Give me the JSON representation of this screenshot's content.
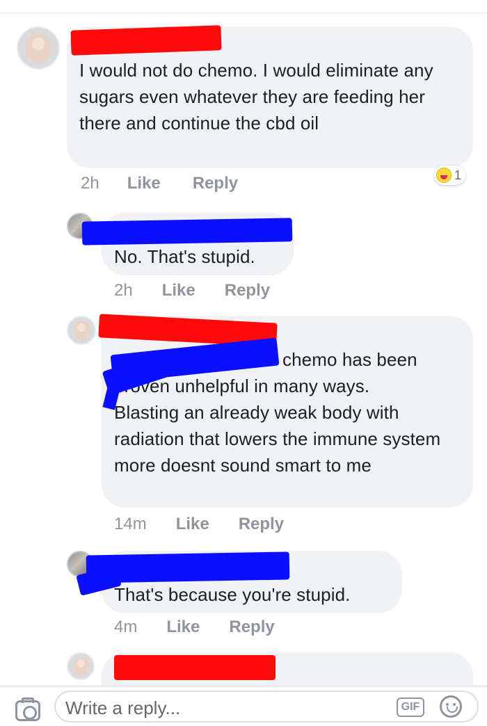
{
  "comments": [
    {
      "text": "I would not do chemo. I would eliminate any sugars even whatever they are feeding her there and continue the cbd oil",
      "time": "2h",
      "like": "Like",
      "reply": "Reply",
      "reaction": {
        "icon": "laugh-emoji-icon",
        "count": "1"
      }
    },
    {
      "text": "No. That's stupid.",
      "time": "2h",
      "like": "Like",
      "reply": "Reply"
    },
    {
      "text_visible_fragment_1": "chemo has been",
      "text_visible_fragment_2": "proven unhelpful in many ways.",
      "text_rest": "Blasting an already weak body with radiation that lowers the immune system more doesnt sound smart to me",
      "time": "14m",
      "like": "Like",
      "reply": "Reply"
    },
    {
      "text": "That's because you're stupid.",
      "time": "4m",
      "like": "Like",
      "reply": "Reply"
    }
  ],
  "composer": {
    "placeholder": "Write a reply...",
    "gif_label": "GIF",
    "camera_icon": "camera-icon",
    "emoji_icon": "smiley-icon"
  },
  "colors": {
    "bubble_bg": "#f0f2f5",
    "meta_text": "#90949c",
    "redaction_red": "#ff0a0a",
    "redaction_blue": "#0a10ff"
  }
}
